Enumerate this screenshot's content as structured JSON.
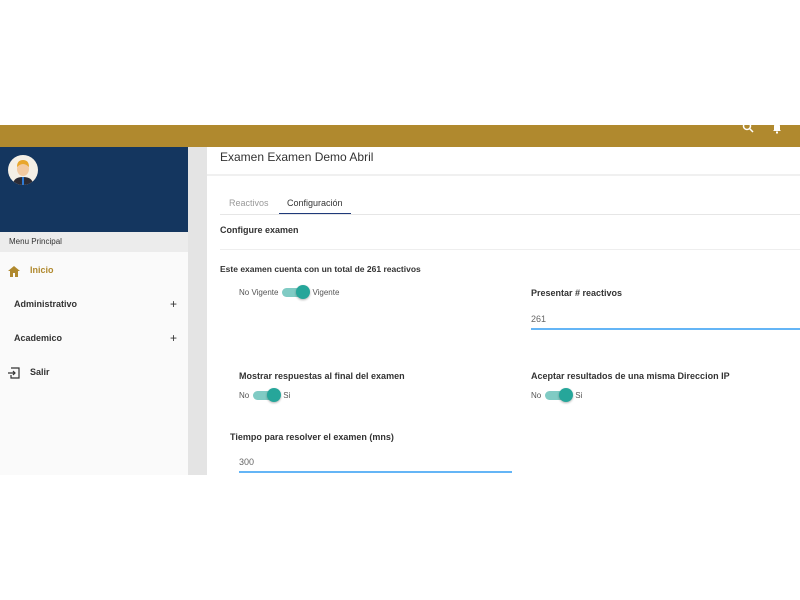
{
  "header": {
    "icons": [
      "search-icon",
      "bell-icon"
    ],
    "color": "#b0892e"
  },
  "sidebar": {
    "menu_title": "Menu Principal",
    "items": [
      {
        "label": "Inicio",
        "icon": "home-icon"
      },
      {
        "label": "Administrativo",
        "expand": "+"
      },
      {
        "label": "Academico",
        "expand": "+"
      },
      {
        "label": "Salir",
        "icon": "logout-icon"
      }
    ]
  },
  "page": {
    "title": "Examen Examen Demo Abril",
    "tabs": [
      "Reactivos",
      "Configuración"
    ],
    "active_tab": "Configuración",
    "section": "Configure examen",
    "summary": "Este examen cuenta con un total de 261 reactivos"
  },
  "form": {
    "vigente": {
      "off": "No Vigente",
      "on": "Vigente",
      "value": true
    },
    "presentar": {
      "label": "Presentar # reactivos",
      "value": "261"
    },
    "mostrar": {
      "label": "Mostrar respuestas al final del examen",
      "off": "No",
      "on": "Si",
      "value": true
    },
    "aceptar": {
      "label": "Aceptar resultados de una misma Direccion IP",
      "off": "No",
      "on": "Si",
      "value": true
    },
    "tiempo": {
      "label": "Tiempo para resolver el examen (mns)",
      "value": "300"
    }
  }
}
